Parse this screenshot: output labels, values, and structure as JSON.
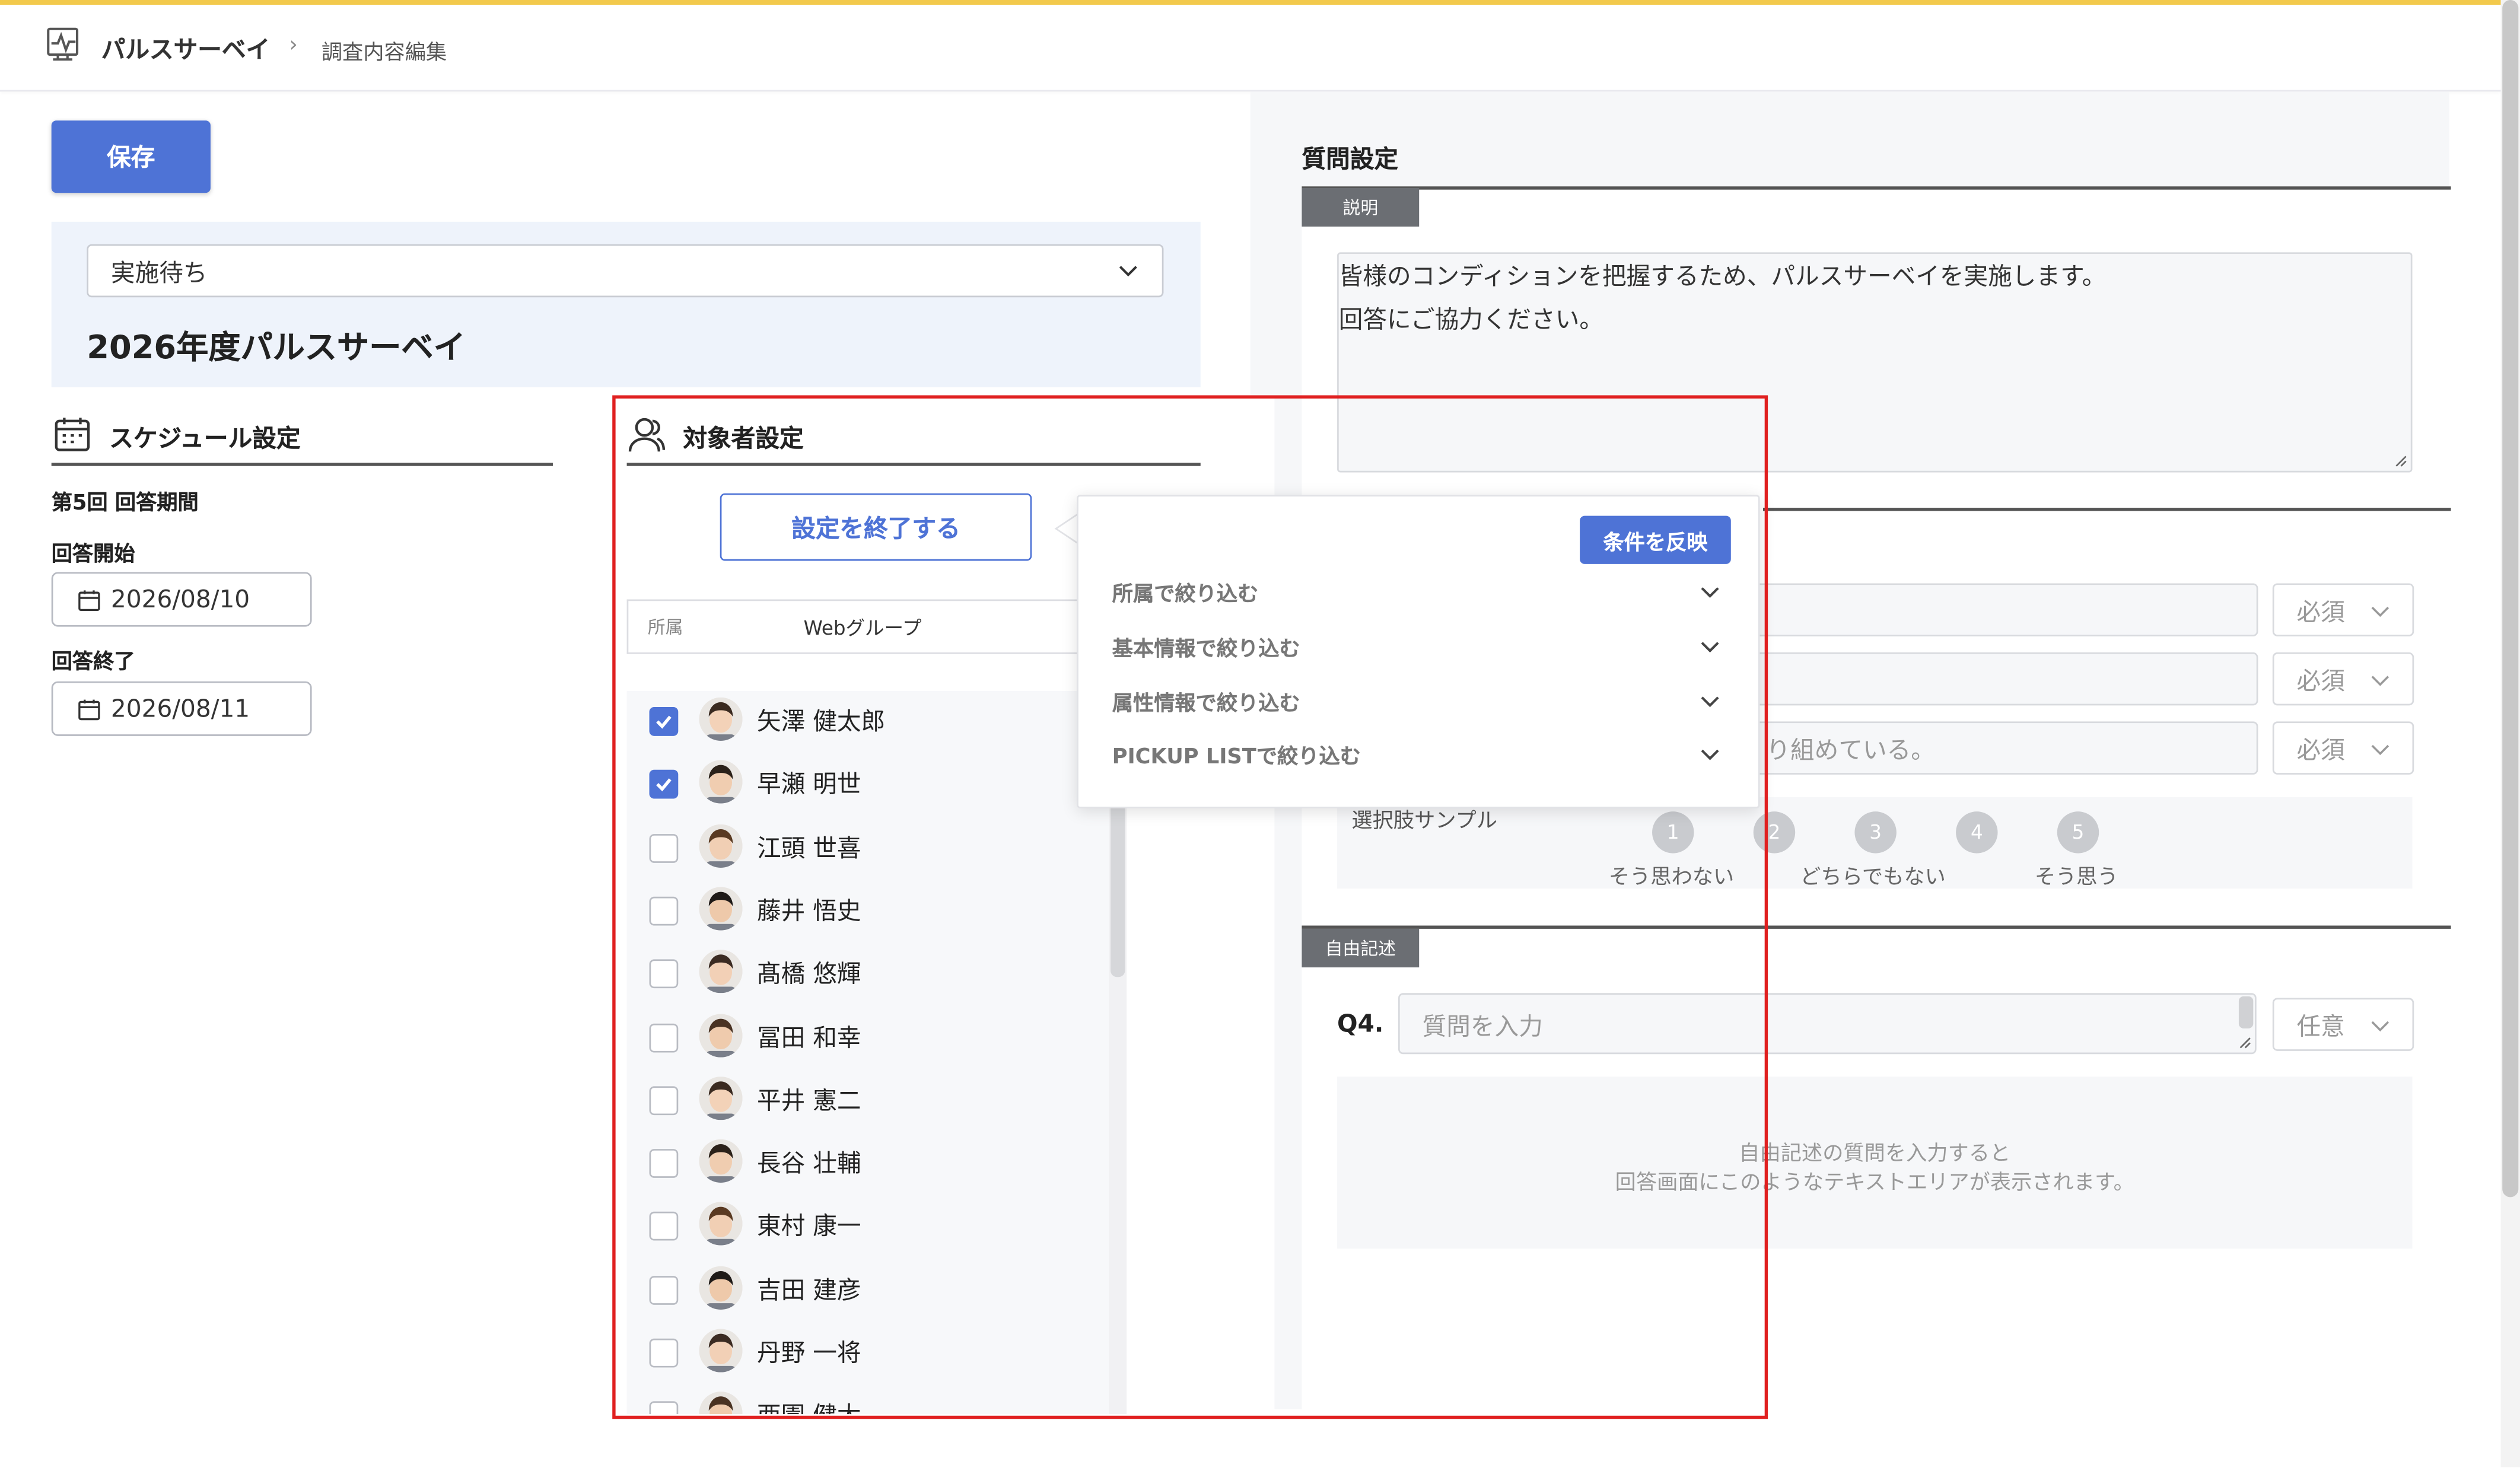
{
  "header": {
    "app_name": "パルスサーベイ",
    "breadcrumb_separator": "›",
    "page_name": "調査内容編集"
  },
  "toolbar": {
    "save_label": "保存"
  },
  "survey": {
    "status": "実施待ち",
    "title": "2026年度パルスサーベイ"
  },
  "schedule": {
    "section_title": "スケジュール設定",
    "period_label": "第5回 回答期間",
    "start_label": "回答開始",
    "start_date": "2026/08/10",
    "end_label": "回答終了",
    "end_date": "2026/08/11"
  },
  "target": {
    "section_title": "対象者設定",
    "finish_label": "設定を終了する",
    "filter_label": "所属",
    "filter_value": "Webグループ",
    "members": [
      {
        "name": "矢澤 健太郎",
        "checked": true
      },
      {
        "name": "早瀬 明世",
        "checked": true
      },
      {
        "name": "江頭 世喜",
        "checked": false
      },
      {
        "name": "藤井 悟史",
        "checked": false
      },
      {
        "name": "髙橋 悠輝",
        "checked": false
      },
      {
        "name": "冨田 和幸",
        "checked": false
      },
      {
        "name": "平井 憲二",
        "checked": false
      },
      {
        "name": "長谷 壮輔",
        "checked": false
      },
      {
        "name": "東村 康一",
        "checked": false
      },
      {
        "name": "吉田 建彦",
        "checked": false
      },
      {
        "name": "丹野 一将",
        "checked": false
      },
      {
        "name": "西園 健太",
        "checked": false
      }
    ]
  },
  "filter_popup": {
    "apply_label": "条件を反映",
    "items": [
      "所属で絞り込む",
      "基本情報で絞り込む",
      "属性情報で絞り込む",
      "PICKUP LISTで絞り込む"
    ]
  },
  "questions": {
    "section_title": "質問設定",
    "description_tag": "説明",
    "description_lines": [
      "皆様のコンディションを把握するため、パルスサーベイを実施します。",
      "回答にご協力ください。"
    ],
    "q3_visible_text": "取り組めている。",
    "q3_visible_prefix": "り組めている。",
    "required_label": "必須",
    "choice_sample_label": "選択肢サンプル",
    "scale": [
      "1",
      "2",
      "3",
      "4",
      "5"
    ],
    "scale_labels": [
      "そう思わない",
      "どちらでもない",
      "そう思う"
    ],
    "free_tag": "自由記述",
    "q4_label": "Q4.",
    "q4_placeholder": "質問を入力",
    "optional_label": "任意",
    "free_hint_lines": [
      "自由記述の質問を入力すると",
      "回答画面にこのようなテキストエリアが表示されます。"
    ]
  },
  "colors": {
    "accent": "#4e73d6",
    "annotation": "#e02020",
    "header_accent": "#f2c94c"
  }
}
